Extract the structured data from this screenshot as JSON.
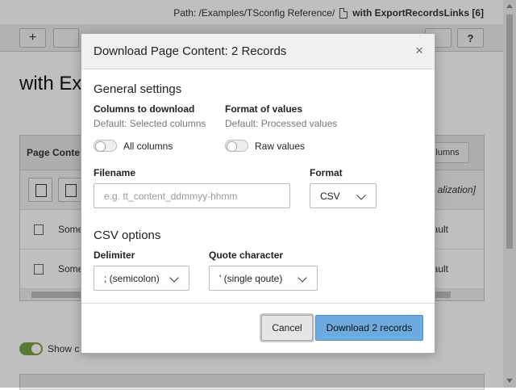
{
  "background": {
    "path_label": "Path: /Examples/TSconfig Reference/",
    "page_name": "with ExportRecordsLinks [6]",
    "heading": "with Exp",
    "toolbar_add": "+",
    "toolbar_help": "?",
    "panel_title": "Page Conte",
    "panel_columns_button": "olumns",
    "localization_text": "alization]",
    "rows": [
      {
        "title": "Some",
        "right": "ault"
      },
      {
        "title": "Some",
        "right": "ault"
      }
    ],
    "show_label": "Show c"
  },
  "modal": {
    "title": "Download Page Content: 2 Records",
    "close_symbol": "×",
    "general_settings_title": "General settings",
    "columns_label": "Columns to download",
    "columns_hint": "Default: Selected columns",
    "all_columns_label": "All columns",
    "format_values_label": "Format of values",
    "format_values_hint": "Default: Processed values",
    "raw_values_label": "Raw values",
    "filename_label": "Filename",
    "filename_placeholder": "e.g. tt_content_ddmmyy-hhmm",
    "filename_value": "",
    "format_label": "Format",
    "format_value": "CSV",
    "csv_options_title": "CSV options",
    "delimiter_label": "Delimiter",
    "delimiter_value": "; (semicolon)",
    "quote_label": "Quote character",
    "quote_value": "' (single qoute)",
    "cancel_label": "Cancel",
    "download_label": "Download 2 records"
  },
  "colors": {
    "primary_button": "#6daae0",
    "modal_header": "#f0f0f0",
    "toggle_on": "#79a548"
  },
  "icons": [
    "close-icon",
    "chevron-down-icon",
    "document-icon",
    "add-icon",
    "help-icon"
  ]
}
